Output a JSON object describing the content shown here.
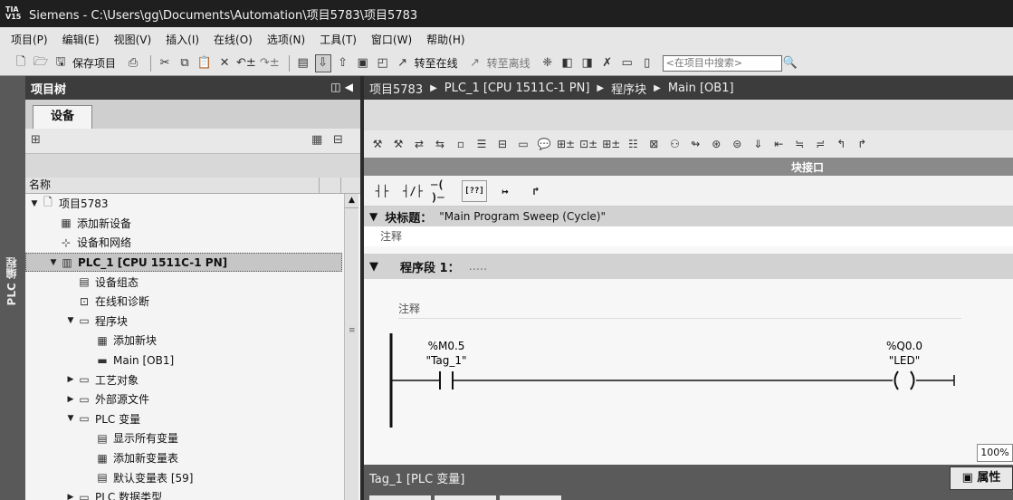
{
  "window": {
    "logo": "TIA V15",
    "title": "Siemens  -  C:\\Users\\gg\\Documents\\Automation\\项目5783\\项目5783"
  },
  "menu": [
    "项目(P)",
    "编辑(E)",
    "视图(V)",
    "插入(I)",
    "在线(O)",
    "选项(N)",
    "工具(T)",
    "窗口(W)",
    "帮助(H)"
  ],
  "toolbar": {
    "save_label": "保存项目",
    "go_online": "转至在线",
    "go_offline": "转至离线",
    "search_placeholder": "<在项目中搜索>"
  },
  "left_tab": {
    "label": "PLC 编程"
  },
  "project_tree": {
    "title": "项目树",
    "devices_tab": "设备",
    "column_name": "名称",
    "items": [
      {
        "label": "项目5783",
        "level": 0,
        "arrow": "▼",
        "icon": "project-icon"
      },
      {
        "label": "添加新设备",
        "level": 1,
        "arrow": "",
        "icon": "add-device-icon"
      },
      {
        "label": "设备和网络",
        "level": 1,
        "arrow": "",
        "icon": "network-icon"
      },
      {
        "label": "PLC_1 [CPU 1511C-1 PN]",
        "level": 1,
        "arrow": "▼",
        "icon": "plc-icon",
        "selected": true
      },
      {
        "label": "设备组态",
        "level": 2,
        "arrow": "",
        "icon": "device-config-icon"
      },
      {
        "label": "在线和诊断",
        "level": 2,
        "arrow": "",
        "icon": "diagnostics-icon"
      },
      {
        "label": "程序块",
        "level": 2,
        "arrow": "▼",
        "icon": "folder-icon"
      },
      {
        "label": "添加新块",
        "level": 3,
        "arrow": "",
        "icon": "add-block-icon"
      },
      {
        "label": "Main [OB1]",
        "level": 3,
        "arrow": "",
        "icon": "ob-icon"
      },
      {
        "label": "工艺对象",
        "level": 2,
        "arrow": "▶",
        "icon": "folder-icon"
      },
      {
        "label": "外部源文件",
        "level": 2,
        "arrow": "▶",
        "icon": "folder-icon"
      },
      {
        "label": "PLC 变量",
        "level": 2,
        "arrow": "▼",
        "icon": "folder-icon"
      },
      {
        "label": "显示所有变量",
        "level": 3,
        "arrow": "",
        "icon": "tag-table-icon"
      },
      {
        "label": "添加新变量表",
        "level": 3,
        "arrow": "",
        "icon": "add-tag-table-icon"
      },
      {
        "label": "默认变量表 [59]",
        "level": 3,
        "arrow": "",
        "icon": "tag-table-icon"
      },
      {
        "label": "PLC 数据类型",
        "level": 2,
        "arrow": "▶",
        "icon": "folder-icon"
      }
    ]
  },
  "editor": {
    "breadcrumb": [
      "项目5783",
      "PLC_1 [CPU 1511C-1 PN]",
      "程序块",
      "Main [OB1]"
    ],
    "interface_label": "块接口",
    "block_title_label": "块标题：",
    "block_title": "\"Main Program Sweep (Cycle)\"",
    "comment": "注释",
    "network_label": "程序段 1：",
    "network_dots": ".....",
    "network_comment": "注释",
    "contact": {
      "address": "%M0.5",
      "tag": "\"Tag_1\""
    },
    "coil": {
      "address": "%Q0.0",
      "tag": "\"LED\""
    },
    "zoom": "100%",
    "lad_buttons": [
      "┤├",
      "┤/├",
      "─( )─",
      "[??]",
      "↦",
      "↱"
    ]
  },
  "inspector": {
    "title": "Tag_1 [PLC 变量]",
    "properties": "属性"
  }
}
